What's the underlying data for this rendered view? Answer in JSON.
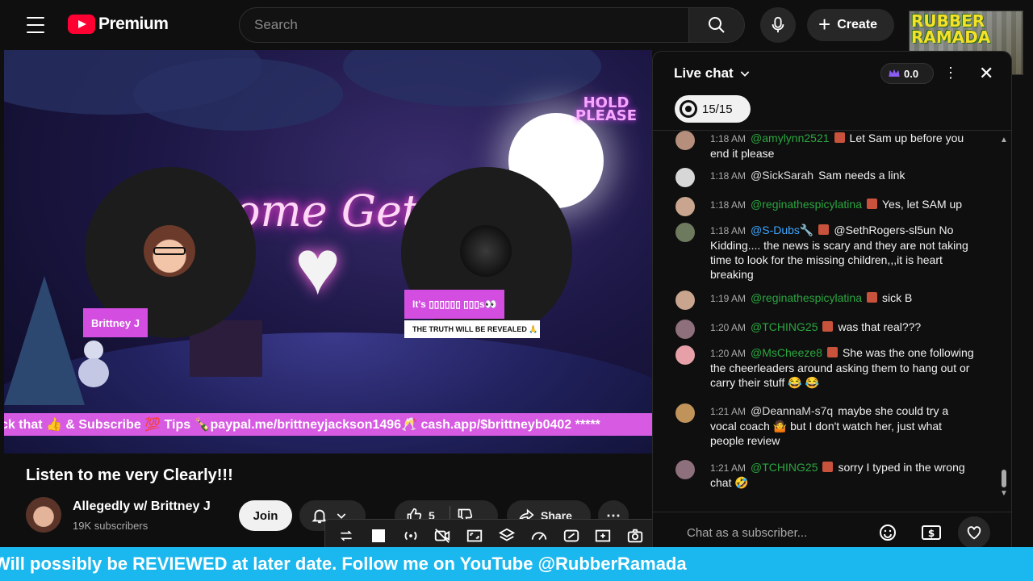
{
  "header": {
    "brand": "Premium",
    "search_placeholder": "Search",
    "create_label": "Create",
    "channel_badge_text": "RUBBER RAMADA"
  },
  "video": {
    "overlay_hold": "HOLD PLEASE",
    "neon_text": "ome Get C",
    "guest1_name": "Brittney J",
    "guest2_tag": "It's ▯▯▯▯▯▯ ▯▯▯s👀",
    "guest2_caption": "THE TRUTH WILL BE REVEALED 🙏",
    "ticker": "ck that 👍 & Subscribe 💯 Tips 🍾paypal.me/brittneyjackson1496🥂 cash.app/$brittneyb0402 *****"
  },
  "meta": {
    "title": "Listen to me very Clearly!!!",
    "channel_name": "Allegedly w/ Brittney J",
    "subscribers": "19K subscribers",
    "join_label": "Join",
    "like_count": "5",
    "share_label": "Share"
  },
  "chat": {
    "title": "Live chat",
    "crown_count": "0.0",
    "goal": "15/15",
    "input_placeholder": "Chat as a subscriber...",
    "messages": [
      {
        "time": "1:18 AM",
        "author": "@amylynn2521",
        "text": "Let Sam up before you end it please"
      },
      {
        "time": "1:18 AM",
        "author": "@SickSarah",
        "text": "Sam needs a link"
      },
      {
        "time": "1:18 AM",
        "author": "@reginathespicylatina",
        "text": "Yes, let SAM up"
      },
      {
        "time": "1:18 AM",
        "author": "@S-Dubs🔧",
        "text": "@SethRogers-sl5un No Kidding.... the news is scary and they are not taking time to look for the missing children,,,it is heart breaking"
      },
      {
        "time": "1:19 AM",
        "author": "@reginathespicylatina",
        "text": "sick B"
      },
      {
        "time": "1:20 AM",
        "author": "@TCHING25",
        "text": "was that real???"
      },
      {
        "time": "1:20 AM",
        "author": "@MsCheeze8",
        "text": "She was the one following the cheerleaders around asking them to hang out or carry their stuff 😂 😂"
      },
      {
        "time": "1:21 AM",
        "author": "@DeannaM-s7q",
        "text": "maybe she could try a vocal coach 🤷 but I don't watch her, just what people review"
      },
      {
        "time": "1:21 AM",
        "author": "@TCHING25",
        "text": "sorry I typed in the wrong chat 🤣"
      }
    ]
  },
  "banner": {
    "text": "Will possibly be REVIEWED at later date. Follow me on YouTube @RubberRamada"
  },
  "colors": {
    "accent_red": "#ff0033",
    "chat_green": "#2ba640",
    "ticker_pink": "#d75ae2",
    "banner_blue": "#1bb8ef"
  }
}
